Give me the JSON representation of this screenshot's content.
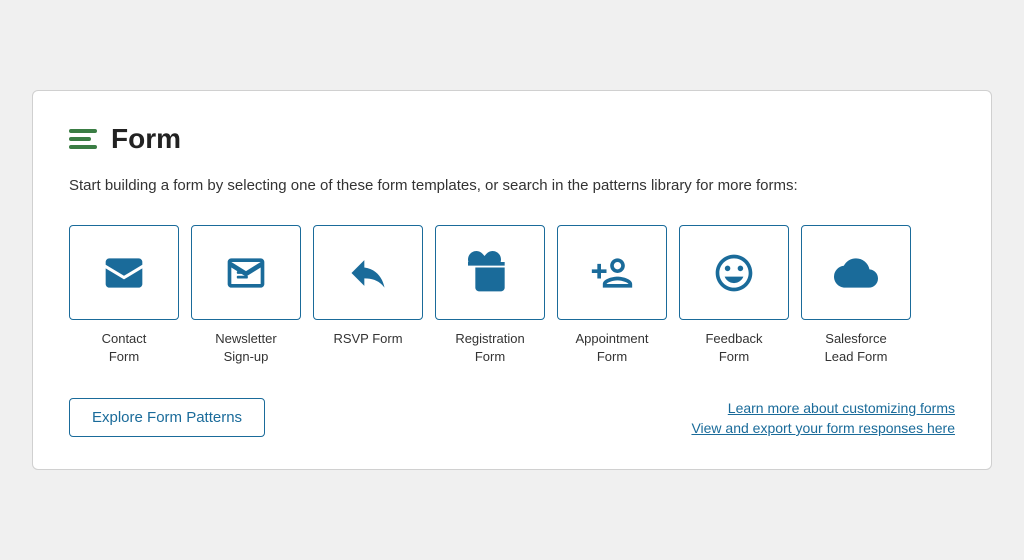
{
  "header": {
    "title": "Form",
    "icon_name": "form-lines-icon"
  },
  "subtitle": "Start building a form by selecting one of these form templates, or search in the patterns library for more forms:",
  "templates": [
    {
      "id": "contact",
      "label": "Contact\nForm",
      "icon": "envelope-open"
    },
    {
      "id": "newsletter",
      "label": "Newsletter\nSign-up",
      "icon": "envelope-open-text"
    },
    {
      "id": "rsvp",
      "label": "RSVP Form",
      "icon": "reply"
    },
    {
      "id": "registration",
      "label": "Registration\nForm",
      "icon": "id-card"
    },
    {
      "id": "appointment",
      "label": "Appointment\nForm",
      "icon": "user-plus"
    },
    {
      "id": "feedback",
      "label": "Feedback\nForm",
      "icon": "smiley"
    },
    {
      "id": "salesforce",
      "label": "Salesforce\nLead Form",
      "icon": "cloud"
    }
  ],
  "footer": {
    "explore_button": "Explore Form Patterns",
    "link1": "Learn more about customizing forms",
    "link2": "View and export your form responses here"
  }
}
